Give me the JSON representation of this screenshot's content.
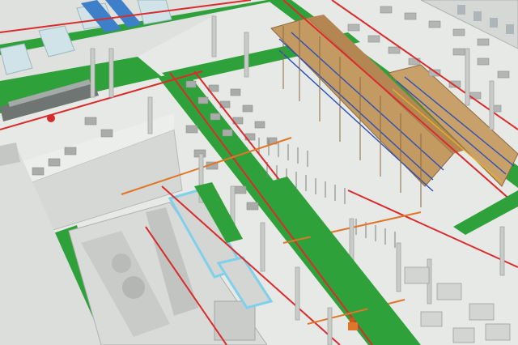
{
  "scene": {
    "kind": "3d-factory-layout-render",
    "colors": {
      "floor": "#e6e8e5",
      "green_aisle": "#2fa13a",
      "green_aisle_dark": "#24852d",
      "red_line": "#d92c2c",
      "orange_line": "#e0762a",
      "rack_wood": "#b88d5a",
      "rack_blue": "#2a4fb8",
      "rack_yellow": "#e2b12a",
      "wall": "#cfd2cf",
      "pallet": "#a9aca9",
      "duct_blue": "#7fd0ea",
      "machine": "#dadcd9",
      "pillar": "#c9cbc8"
    },
    "icons": [
      "warehouse-rack",
      "pallet",
      "pillar",
      "pipe",
      "production-line",
      "forklift"
    ]
  }
}
